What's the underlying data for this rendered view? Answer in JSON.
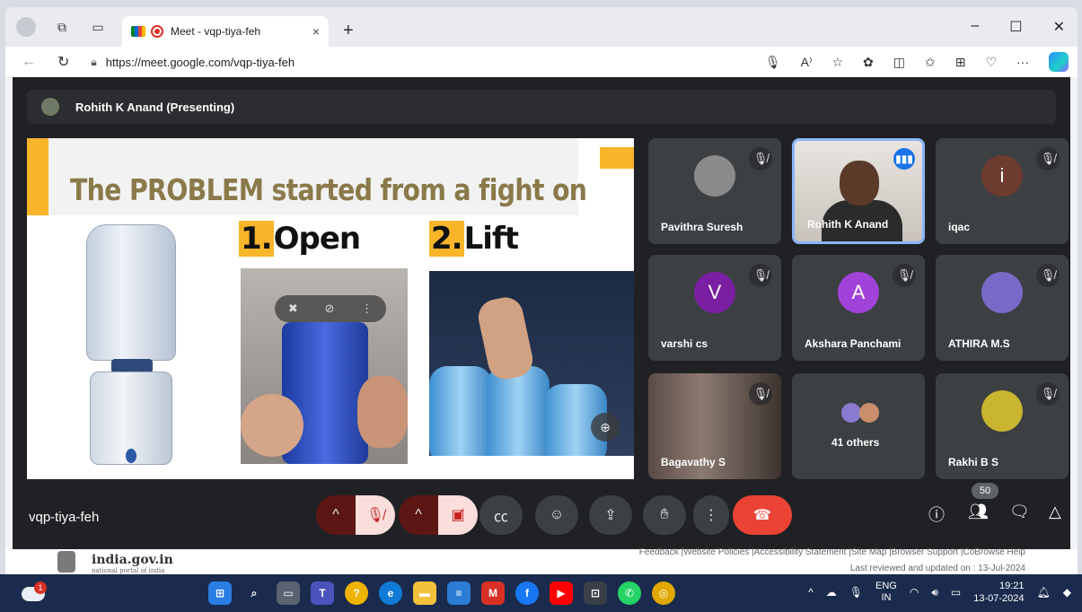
{
  "browser": {
    "tab_title": "Meet - vqp-tiya-feh",
    "tab_close": "×",
    "new_tab": "+",
    "url": "https://meet.google.com/vqp-tiya-feh",
    "win_min": "–",
    "win_max": "☐",
    "win_close": "✕",
    "read_aloud": "A⁾",
    "more": "···"
  },
  "meet": {
    "presenter": "Rohith K Anand (Presenting)",
    "meeting_code": "vqp-tiya-feh",
    "people_count": "50",
    "slide": {
      "heading": "The PROBLEM started from a fight on",
      "step1_num": "1.",
      "step1_word": "Open",
      "step2_num": "2.",
      "step2_word": "Lift"
    },
    "participants": [
      {
        "name": "Pavithra Suresh",
        "initial": "",
        "color": "#8a8a8a"
      },
      {
        "name": "Rohith K Anand",
        "initial": "",
        "color": "#5a3b2a"
      },
      {
        "name": "iqac",
        "initial": "i",
        "color": "#6d3b2f"
      },
      {
        "name": "varshi cs",
        "initial": "V",
        "color": "#7b1fa2"
      },
      {
        "name": "Akshara Panchami",
        "initial": "A",
        "color": "#a142d8"
      },
      {
        "name": "ATHIRA M.S",
        "initial": "",
        "color": "#7a6ac8"
      },
      {
        "name": "Bagavathy S",
        "initial": "",
        "color": "#5a4b46"
      },
      {
        "name": "41 others",
        "initial": "",
        "color": "#3c4043"
      },
      {
        "name": "Rakhi B S",
        "initial": "",
        "color": "#c9b530"
      }
    ]
  },
  "page_footer": {
    "site": "india.gov.in",
    "tagline": "national portal of india",
    "links": "Feedback |Website Policies |Accessibility Statement |Site Map |Browser Support |CoBrowse Help",
    "reviewed": "Last reviewed and updated on : 13-Jul-2024"
  },
  "taskbar": {
    "weather_badge": "1",
    "lang_top": "ENG",
    "lang_bottom": "IN",
    "time": "19:21",
    "date": "13-07-2024"
  }
}
